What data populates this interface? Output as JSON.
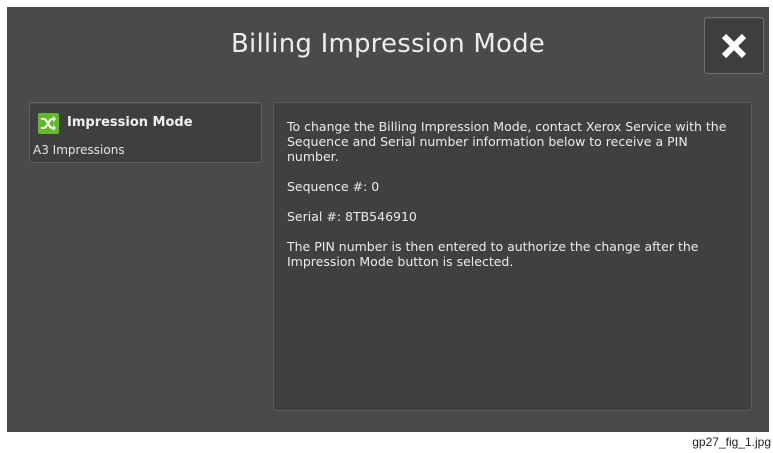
{
  "dialog": {
    "title": "Billing Impression Mode",
    "close_icon": "close-x-icon"
  },
  "impression_mode": {
    "icon": "shuffle-icon",
    "icon_color": "#63b92c",
    "label": "Impression Mode",
    "value": "A3 Impressions"
  },
  "info": {
    "instructions": "To change the Billing Impression Mode, contact Xerox Service with the Sequence and Serial number information below to receive a PIN number.",
    "sequence": "Sequence #: 0",
    "serial": "Serial #: 8TB546910",
    "note": "The PIN number is then entered to authorize the change after the Impression Mode button is selected."
  },
  "caption": "gp27_fig_1.jpg"
}
